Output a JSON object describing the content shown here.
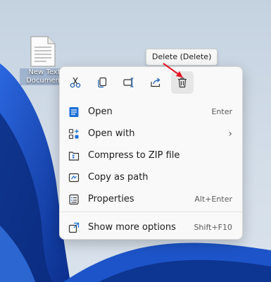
{
  "desktop": {
    "file": {
      "icon": "text-file-icon",
      "label_line1": "New Text",
      "label_line2": "Document"
    }
  },
  "tooltip": {
    "text": "Delete (Delete)"
  },
  "context_menu": {
    "toolbar": [
      {
        "icon": "cut-icon",
        "action": "Cut"
      },
      {
        "icon": "copy-icon",
        "action": "Copy"
      },
      {
        "icon": "rename-icon",
        "action": "Rename"
      },
      {
        "icon": "share-icon",
        "action": "Share"
      },
      {
        "icon": "delete-icon",
        "action": "Delete"
      }
    ],
    "items": [
      {
        "label": "Open",
        "shortcut": "Enter",
        "icon": "notepad-icon"
      },
      {
        "label": "Open with",
        "shortcut": "›",
        "icon": "open-with-icon"
      },
      {
        "label": "Compress to ZIP file",
        "shortcut": "",
        "icon": "zip-folder-icon"
      },
      {
        "label": "Copy as path",
        "shortcut": "",
        "icon": "copy-path-icon"
      },
      {
        "label": "Properties",
        "shortcut": "Alt+Enter",
        "icon": "properties-icon"
      },
      {
        "label": "Show more options",
        "shortcut": "Shift+F10",
        "icon": "more-options-icon"
      }
    ]
  },
  "colors": {
    "accent": "#1a6fd6",
    "wallpaper": "#1241a6",
    "arrow": "#e81123"
  }
}
